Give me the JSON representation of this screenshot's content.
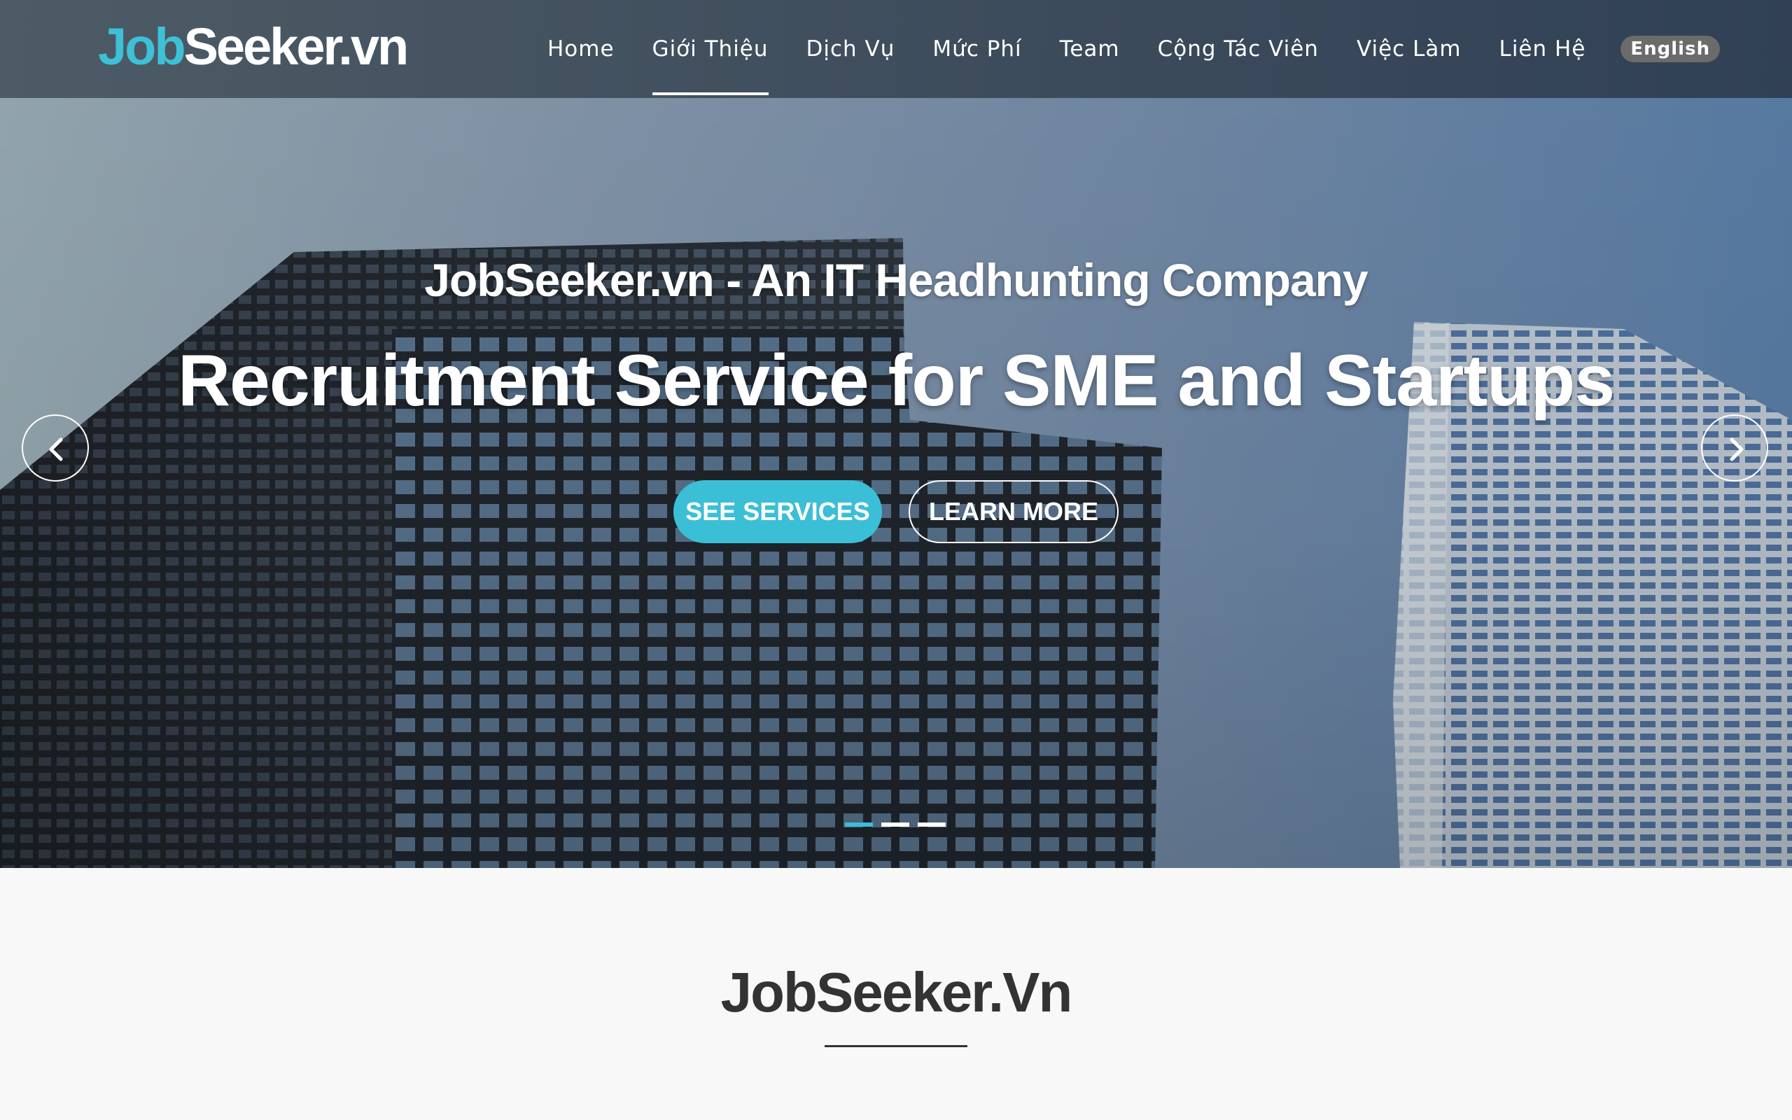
{
  "brand": {
    "prefix": "Job",
    "suffix": "Seeker.vn",
    "accent_color": "#3ec0d6"
  },
  "nav": {
    "items": [
      {
        "label": "Home",
        "active": false
      },
      {
        "label": "Giới Thiệu",
        "active": true
      },
      {
        "label": "Dịch Vụ",
        "active": false
      },
      {
        "label": "Mức Phí",
        "active": false
      },
      {
        "label": "Team",
        "active": false
      },
      {
        "label": "Cộng Tác Viên",
        "active": false
      },
      {
        "label": "Việc Làm",
        "active": false
      },
      {
        "label": "Liên Hệ",
        "active": false
      }
    ],
    "language_button": "English"
  },
  "hero": {
    "subtitle": "JobSeeker.vn - An IT Headhunting Company",
    "title": "Recruitment Service for SME and Startups",
    "primary_button": "SEE SERVICES",
    "secondary_button": "LEARN MORE",
    "prev_icon": "chevron-left-icon",
    "next_icon": "chevron-right-icon",
    "slides_total": 3,
    "active_slide": 1,
    "button_color": "#3bbfd6"
  },
  "section": {
    "title": "JobSeeker.Vn"
  }
}
